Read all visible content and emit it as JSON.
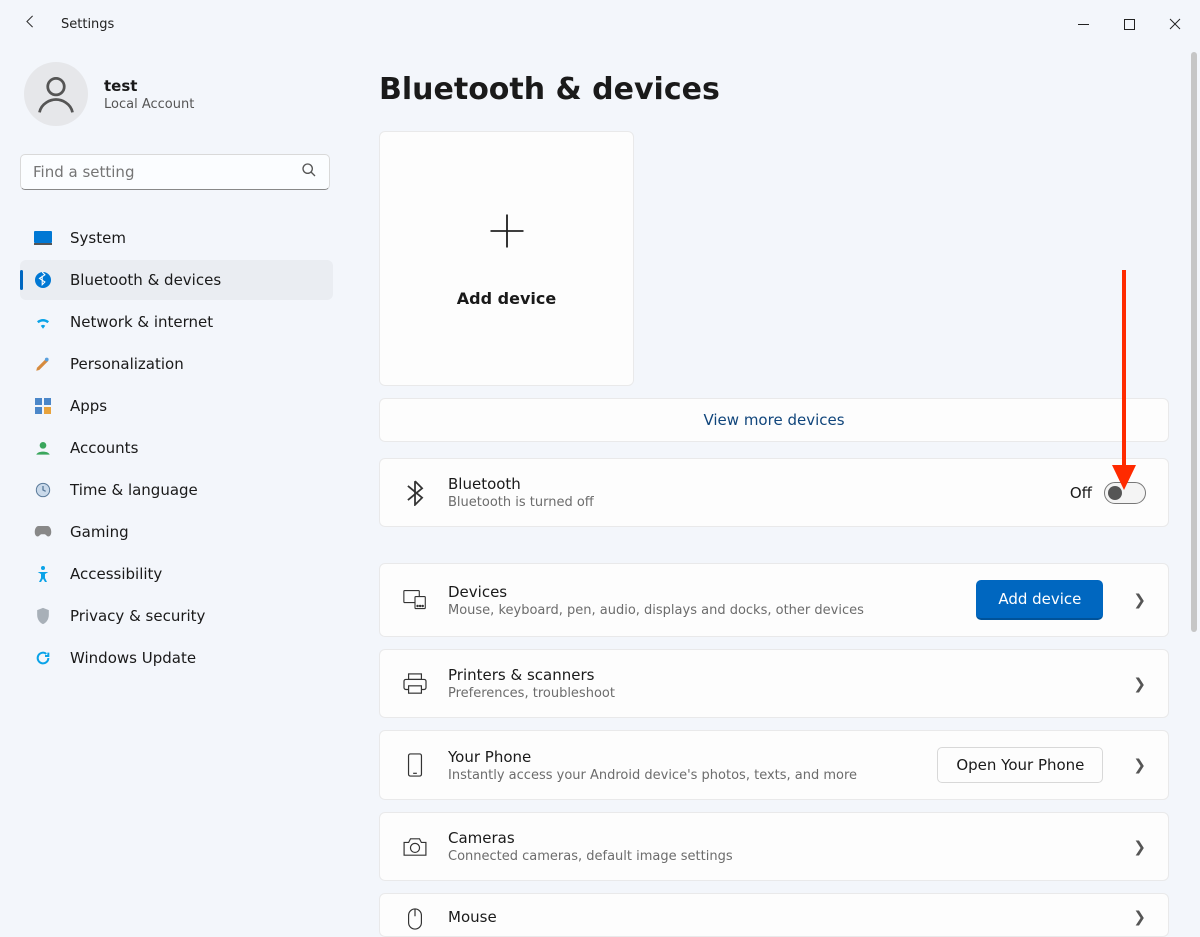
{
  "window": {
    "app_title": "Settings"
  },
  "profile": {
    "name": "test",
    "subtitle": "Local Account"
  },
  "search": {
    "placeholder": "Find a setting"
  },
  "nav": {
    "items": [
      {
        "id": "system",
        "label": "System"
      },
      {
        "id": "bluetooth-devices",
        "label": "Bluetooth & devices"
      },
      {
        "id": "network-internet",
        "label": "Network & internet"
      },
      {
        "id": "personalization",
        "label": "Personalization"
      },
      {
        "id": "apps",
        "label": "Apps"
      },
      {
        "id": "accounts",
        "label": "Accounts"
      },
      {
        "id": "time-language",
        "label": "Time & language"
      },
      {
        "id": "gaming",
        "label": "Gaming"
      },
      {
        "id": "accessibility",
        "label": "Accessibility"
      },
      {
        "id": "privacy-security",
        "label": "Privacy & security"
      },
      {
        "id": "windows-update",
        "label": "Windows Update"
      }
    ],
    "active_index": 1
  },
  "page": {
    "title": "Bluetooth & devices",
    "add_device_card": "Add device",
    "view_more": "View more devices",
    "bluetooth": {
      "title": "Bluetooth",
      "subtitle": "Bluetooth is turned off",
      "state_label": "Off",
      "state_on": false
    },
    "cards": [
      {
        "id": "devices",
        "title": "Devices",
        "subtitle": "Mouse, keyboard, pen, audio, displays and docks, other devices",
        "action": "Add device",
        "action_type": "primary"
      },
      {
        "id": "printers",
        "title": "Printers & scanners",
        "subtitle": "Preferences, troubleshoot"
      },
      {
        "id": "your-phone",
        "title": "Your Phone",
        "subtitle": "Instantly access your Android device's photos, texts, and more",
        "action": "Open Your Phone",
        "action_type": "secondary"
      },
      {
        "id": "cameras",
        "title": "Cameras",
        "subtitle": "Connected cameras, default image settings"
      },
      {
        "id": "mouse",
        "title": "Mouse",
        "subtitle": ""
      }
    ]
  }
}
